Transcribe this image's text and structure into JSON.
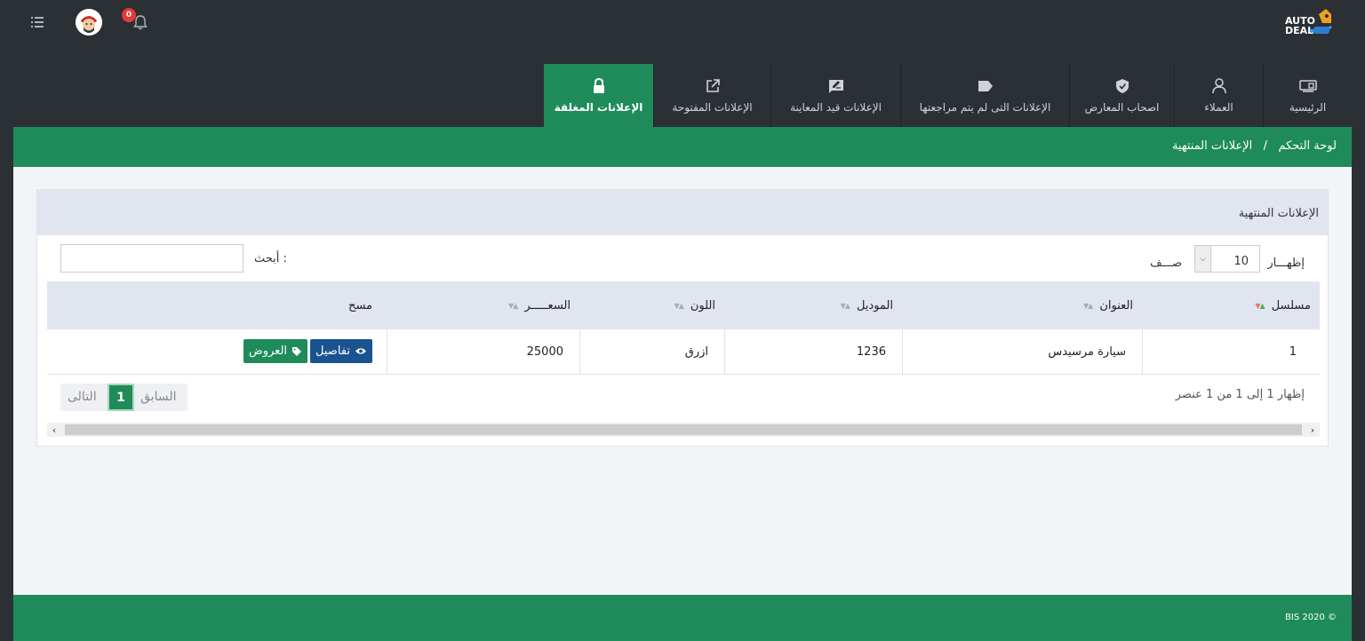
{
  "topbar": {
    "notifications_count": "0",
    "logo_line1": "AUTO",
    "logo_line2": "DEAL"
  },
  "nav": [
    {
      "label": "الرئيسية",
      "icon": "dashboard-icon"
    },
    {
      "label": "العملاء",
      "icon": "user-icon"
    },
    {
      "label": "اصحاب المعارض",
      "icon": "shield-icon"
    },
    {
      "label": "الإعلانات التى لم يتم مراجعتها",
      "icon": "tag-icon"
    },
    {
      "label": "الإعلانات قيد المعاينة",
      "icon": "edit-icon"
    },
    {
      "label": "الإعلانات المفتوحة",
      "icon": "external-link-icon"
    },
    {
      "label": "الإعلانات المغلقة",
      "icon": "lock-icon",
      "active": true
    }
  ],
  "breadcrumb": {
    "root": "لوحة التحكم",
    "sep": "/",
    "current": "الإعلانات المنتهية"
  },
  "card": {
    "title": "الإعلانات المنتهية"
  },
  "table_controls": {
    "show_label": "إظهـــار",
    "rows_label": "صـــف",
    "page_length": "10",
    "search_label": "أبحث :",
    "search_value": ""
  },
  "table": {
    "columns": [
      "مسلسل",
      "العنوان",
      "الموديل",
      "اللون",
      "السعـــــر",
      "مسح"
    ],
    "rows": [
      {
        "serial": "1",
        "title": "سيارة مرسيدس",
        "model": "1236",
        "color": "ازرق",
        "price": "25000",
        "details_label": "تفاصيل",
        "offers_label": "العروض"
      }
    ]
  },
  "pagination": {
    "info": "إظهار 1 إلى 1 من 1 عنصر",
    "prev": "السابق",
    "current": "1",
    "next": "التالى"
  },
  "footer": {
    "copyright": "BIS 2020 ©"
  },
  "colors": {
    "green": "#1f8b5b",
    "dark": "#2b3035",
    "blue": "#1a5490",
    "header_bg": "#e0e5ef"
  }
}
